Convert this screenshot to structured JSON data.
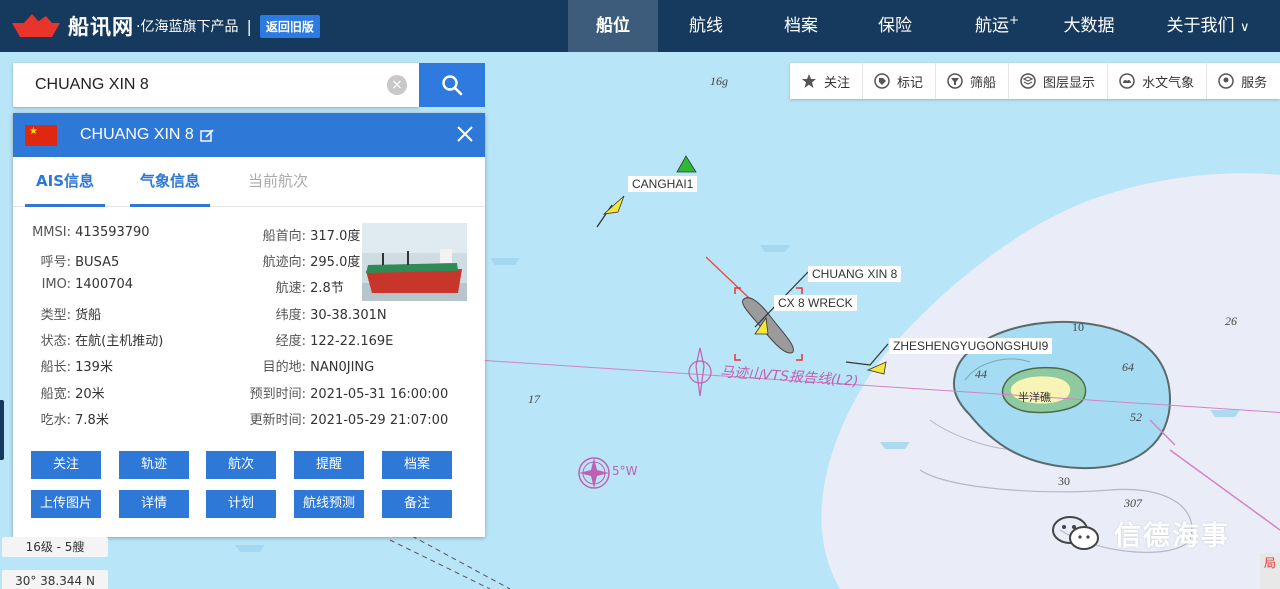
{
  "app": {
    "logo_text": "船讯网",
    "logo_sub": "·亿海蓝旗下产品",
    "old_version_button": "返回旧版"
  },
  "nav": {
    "items": [
      {
        "label": "船位",
        "active": true
      },
      {
        "label": "航线"
      },
      {
        "label": "档案"
      },
      {
        "label": "保险"
      },
      {
        "label": "航运",
        "sup": "+"
      },
      {
        "label": "大数据"
      },
      {
        "label": "关于我们",
        "chevron": true
      }
    ]
  },
  "search": {
    "value": "CHUANG XIN 8",
    "clear_icon": "×"
  },
  "toolbar": {
    "items": [
      {
        "label": "关注",
        "icon": "star-icon"
      },
      {
        "label": "标记",
        "icon": "tag-icon"
      },
      {
        "label": "筛船",
        "icon": "filter-icon"
      },
      {
        "label": "图层显示",
        "icon": "layers-icon"
      },
      {
        "label": "水文气象",
        "icon": "weather-icon"
      },
      {
        "label": "服务",
        "icon": "service-icon"
      }
    ]
  },
  "ship_panel": {
    "name": "CHUANG XIN 8",
    "flag": "China",
    "tabs": [
      {
        "label": "AIS信息",
        "active": true
      },
      {
        "label": "气象信息",
        "active": true
      },
      {
        "label": "当前航次",
        "active": false
      }
    ],
    "left_fields": [
      {
        "label": "MMSI:",
        "value": "413593790"
      },
      {
        "label": "呼号:",
        "value": "BUSA5"
      },
      {
        "label": "IMO:",
        "value": "1400704"
      },
      {
        "label": "类型:",
        "value": "货船"
      },
      {
        "label": "状态:",
        "value": "在航(主机推动)"
      },
      {
        "label": "船长:",
        "value": "139米"
      },
      {
        "label": "船宽:",
        "value": "20米"
      },
      {
        "label": "吃水:",
        "value": "7.8米"
      }
    ],
    "right_fields": [
      {
        "label": "船首向:",
        "value": "317.0度"
      },
      {
        "label": "航迹向:",
        "value": "295.0度"
      },
      {
        "label": "航速:",
        "value": "2.8节"
      },
      {
        "label": "纬度:",
        "value": "30-38.301N"
      },
      {
        "label": "经度:",
        "value": "122-22.169E"
      },
      {
        "label": "目的地:",
        "value": "NAN0JING"
      },
      {
        "label": "预到时间:",
        "value": "2021-05-31 16:00:00"
      },
      {
        "label": "更新时间:",
        "value": "2021-05-29 21:07:00"
      }
    ],
    "buttons_row1": [
      "关注",
      "轨迹",
      "航次",
      "提醒",
      "档案"
    ],
    "buttons_row2": [
      "上传图片",
      "详情",
      "计划",
      "航线预测",
      "备注"
    ]
  },
  "map": {
    "ship_labels": [
      "CANGHAI1",
      "CHUANG XIN 8",
      "CX 8 WRECK",
      "ZHESHENGYUGONGSHUI9"
    ],
    "depths": [
      "16g",
      "17",
      "26",
      "10",
      "64",
      "44",
      "52",
      "30",
      "30",
      "307"
    ],
    "route_label": "马迹山VTS报告线(L2)",
    "island_label": "半洋礁",
    "compass_label": "5°W",
    "scale": "16级 - 5艘",
    "coordinate": "30° 38.344 N",
    "corner_tag": "局"
  },
  "watermark": "信德海事",
  "colors": {
    "topbar": "#163a5e",
    "accent": "#2e79d8",
    "sea": "#b9e5f8",
    "shallow": "#e8eef8",
    "route": "#c060b0"
  }
}
